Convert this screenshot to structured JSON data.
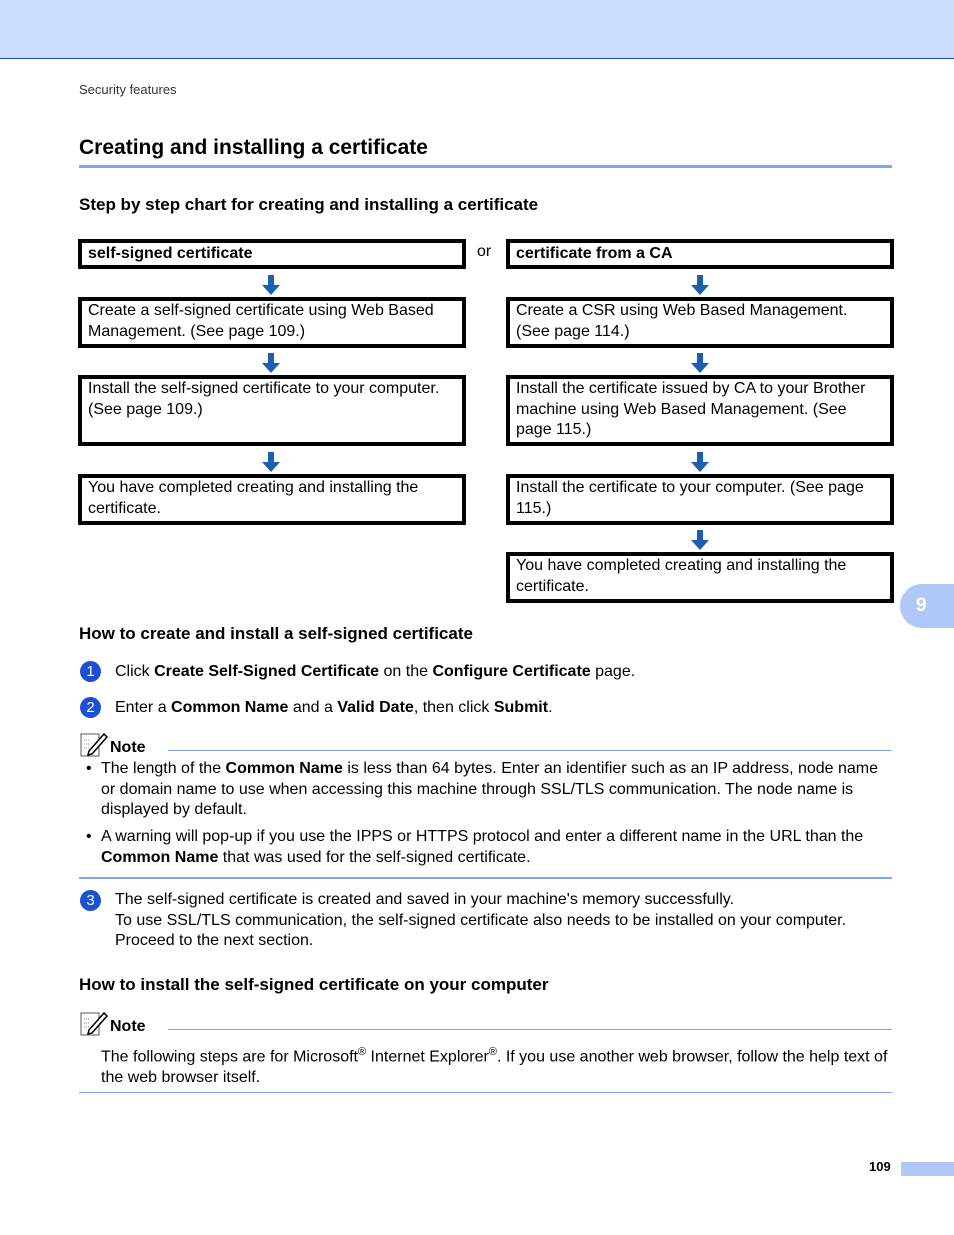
{
  "header": {
    "running_head": "Security features",
    "chapter_tab": "9"
  },
  "section": {
    "title": "Creating and installing a certificate",
    "subtitle": "Step by step chart for creating and installing a certificate"
  },
  "flowchart": {
    "or_label": "or",
    "left": {
      "title": "self-signed certificate",
      "steps": [
        "Create a self-signed certificate using Web Based Management. (See page 109.)",
        "Install the self-signed certificate to your computer. (See page 109.)",
        "You have completed creating and installing the certificate."
      ]
    },
    "right": {
      "title": "certificate from a CA",
      "steps": [
        "Create a CSR using Web Based Management. (See page 114.)",
        "Install the certificate issued by CA to your Brother machine using Web Based Management. (See page 115.)",
        "Install the certificate to your computer. (See page 115.)",
        "You have completed creating and installing the certificate."
      ]
    },
    "arrow_color": "#1a5fb4"
  },
  "howto_create": {
    "heading": "How to create and install a self-signed certificate",
    "steps": [
      {
        "num": "1",
        "parts": [
          "Click ",
          "Create Self-Signed Certificate",
          " on the ",
          "Configure Certificate",
          " page."
        ]
      },
      {
        "num": "2",
        "parts": [
          "Enter a ",
          "Common Name",
          " and a ",
          "Valid Date",
          ", then click ",
          "Submit",
          "."
        ]
      },
      {
        "num": "3",
        "lines": [
          "The self-signed certificate is created and saved in your machine's memory successfully.",
          "To use SSL/TLS communication, the self-signed certificate also needs to be installed on your computer.",
          "Proceed to the next section."
        ]
      }
    ],
    "note": {
      "label": "Note",
      "bullets": [
        {
          "parts": [
            "The length of the ",
            "Common Name",
            " is less than 64 bytes. Enter an identifier such as an IP address, node name or domain name to use when accessing this machine through SSL/TLS communication. The node name is displayed by default."
          ]
        },
        {
          "parts": [
            "A warning will pop-up if you use the IPPS or HTTPS protocol and enter a different name in the URL than the ",
            "Common Name",
            " that was used for the self-signed certificate."
          ]
        }
      ]
    }
  },
  "howto_install": {
    "heading": "How to install the self-signed certificate on your computer",
    "note": {
      "label": "Note",
      "parts": [
        "The following steps are for Microsoft",
        "®",
        " Internet Explorer",
        "®",
        ". If you use another web browser, follow the help text of the web browser itself."
      ]
    }
  },
  "footer": {
    "page_number": "109"
  },
  "colors": {
    "band": "#ccdcfc",
    "accent_blue": "#1a4fd6",
    "rule_blue": "#7ea6f2",
    "tab_blue": "#b0c8f8"
  }
}
